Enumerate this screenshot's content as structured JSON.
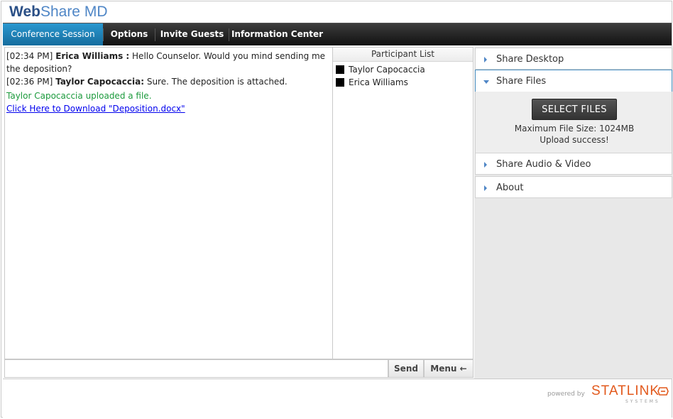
{
  "app": {
    "title_bold": "Web",
    "title_light": "Share MD"
  },
  "navbar": {
    "items": [
      {
        "label": "Conference Session",
        "active": true
      },
      {
        "label": "Options"
      },
      {
        "label": "Invite Guests"
      },
      {
        "label": "Information Center"
      }
    ]
  },
  "chat": {
    "messages": [
      {
        "time": "[02:34 PM]",
        "sender": "Erica Williams :",
        "text": " Hello Counselor. Would you mind sending me the deposition?"
      },
      {
        "time": "[02:36 PM]",
        "sender": "Taylor Capocaccia:",
        "text": " Sure. The deposition is attached."
      }
    ],
    "system_message": "Taylor Capocaccia uploaded a file.",
    "download_link": "Click Here to Download \"Deposition.docx\"",
    "input_value": "",
    "send_label": "Send",
    "menu_label": "Menu ←"
  },
  "participants": {
    "header": "Participant List",
    "items": [
      "Taylor Capocaccia",
      "Erica Williams"
    ]
  },
  "accordion": {
    "sections": [
      {
        "label": "Share Desktop"
      },
      {
        "label": "Share Files"
      },
      {
        "label": "Share Audio & Video"
      },
      {
        "label": "About"
      }
    ],
    "share_files": {
      "button_label": "SELECT FILES",
      "max_size": "Maximum File Size: 1024MB",
      "status": "Upload success!"
    }
  },
  "footer": {
    "powered_by": "powered by",
    "brand_stat": "STAT",
    "brand_link": "LINK",
    "brand_sub": "SYSTEMS"
  },
  "colors": {
    "accent": "#1f83b8",
    "brand": "#e2591c",
    "success": "#1b9a3c"
  }
}
